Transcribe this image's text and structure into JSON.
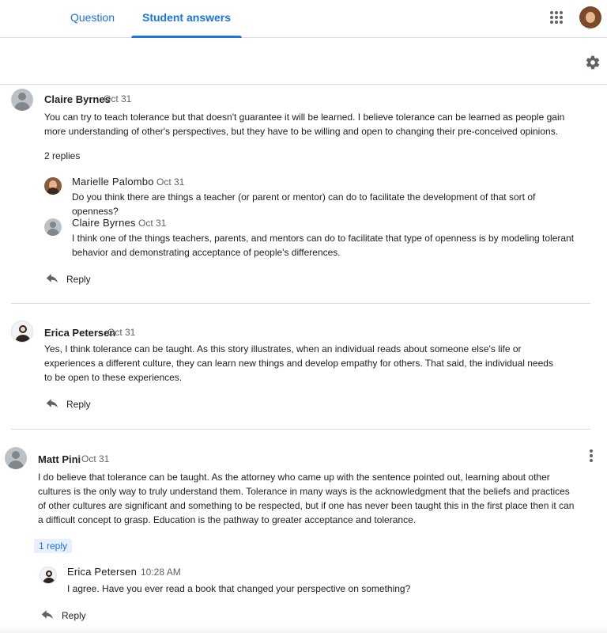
{
  "tabs": [
    {
      "label": "Question"
    },
    {
      "label": "Student answers"
    }
  ],
  "threads": [
    {
      "author": "Claire Byrnes",
      "date": "Oct 31",
      "text": "You can try to teach tolerance but that doesn't guarantee it will be learned. I believe tolerance can be learned as people gain more understanding of other's perspectives, but they have to be willing and open to changing their pre-conceived opinions.",
      "replies_label": "2 replies",
      "replies": [
        {
          "author": "Marielle Palombo",
          "date": "Oct 31",
          "text": "Do you think there are things a teacher (or parent or mentor) can do to facilitate the development of that sort of openness?"
        },
        {
          "author": "Claire Byrnes",
          "date": "Oct 31",
          "text": "I think one of the things teachers, parents, and mentors can do to facilitate that type of openness is by modeling tolerant behavior and demonstrating acceptance of people's differences."
        }
      ],
      "reply_label": "Reply"
    },
    {
      "author": "Erica Petersen",
      "date": "Oct 31",
      "text": "Yes, I think tolerance can be taught. As this story illustrates, when an individual reads about someone else's life or experiences a different culture, they can learn new things and develop empathy for others. That said, the individual needs to be open to these experiences.",
      "reply_label": "Reply"
    },
    {
      "author": "Matt Pini",
      "date": "Oct 31",
      "text": "I do believe that tolerance can be taught. As the attorney who came up with the sentence pointed out, learning about other cultures is the only way to truly understand them. Tolerance in many ways is the acknowledgment that the beliefs and practices of other cultures are significant and something to be respected, but if one has never been taught this in the first place then it can a difficult concept to grasp. Education is the pathway to greater acceptance and tolerance.",
      "replies_label": "1 reply",
      "replies": [
        {
          "author": "Erica Petersen",
          "date": "10:28 AM",
          "text": "I agree. Have you ever read a book that changed your perspective on something?"
        }
      ],
      "reply_label": "Reply"
    }
  ],
  "icons": {
    "apps": "apps-grid-icon",
    "settings": "gear-icon",
    "reply": "reply-arrow-icon",
    "more": "more-vert-icon"
  },
  "colors": {
    "accent": "#1a73e8",
    "divider": "#dadce0",
    "muted_text": "#5f6368"
  }
}
